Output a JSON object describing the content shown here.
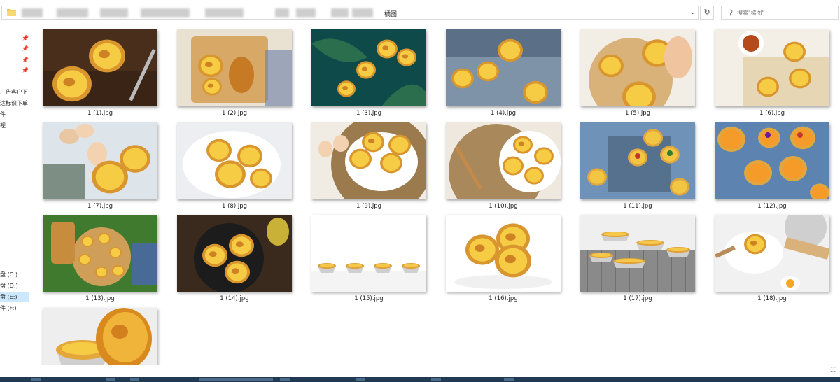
{
  "address_bar": {
    "visible_text": "橘图",
    "dropdown_glyph": "⌄",
    "refresh_glyph": "↻"
  },
  "search": {
    "placeholder": "搜索\"橘图\""
  },
  "nav": {
    "pinned_count": 4,
    "quick_items": [
      "广告客户下",
      "达标识下单",
      "件",
      "视",
      "",
      "",
      "",
      ""
    ],
    "drives": [
      {
        "label": "盘 (C:)",
        "selected": false
      },
      {
        "label": "盘 (D:)",
        "selected": false
      },
      {
        "label": "盘 (E:)",
        "selected": true
      },
      {
        "label": "件 (F:)",
        "selected": false
      }
    ]
  },
  "files": [
    {
      "name": "1 (1).jpg",
      "scene": "egg tarts on dark wood with fork"
    },
    {
      "name": "1 (2).jpg",
      "scene": "egg tarts and croissant on wooden tray"
    },
    {
      "name": "1 (3).jpg",
      "scene": "egg tarts with blueberries on teal leaves"
    },
    {
      "name": "1 (4).jpg",
      "scene": "egg tarts with raisins on blue cloth"
    },
    {
      "name": "1 (5).jpg",
      "scene": "hand holding egg tart over board"
    },
    {
      "name": "1 (6).jpg",
      "scene": "egg tarts with tea on newspaper"
    },
    {
      "name": "1 (7).jpg",
      "scene": "egg tarts with eggs and wheat"
    },
    {
      "name": "1 (8).jpg",
      "scene": "plate of egg tarts with fork"
    },
    {
      "name": "1 (9).jpg",
      "scene": "egg tarts on plate on woven mat"
    },
    {
      "name": "1 (10).jpg",
      "scene": "egg tarts on plate with wooden spoon"
    },
    {
      "name": "1 (11).jpg",
      "scene": "fruit tarts on blue background"
    },
    {
      "name": "1 (12).jpg",
      "scene": "mango fruit tarts on blue"
    },
    {
      "name": "1 (13).jpg",
      "scene": "egg tarts on wooden board on grass"
    },
    {
      "name": "1 (14).jpg",
      "scene": "egg tarts in black pan"
    },
    {
      "name": "1 (15).jpg",
      "scene": "row of four egg tarts on white"
    },
    {
      "name": "1 (16).jpg",
      "scene": "three egg tarts on white"
    },
    {
      "name": "1 (17).jpg",
      "scene": "egg tarts on cooling rack"
    },
    {
      "name": "1 (18).jpg",
      "scene": "egg tart on plate with rolling pin"
    },
    {
      "name": "",
      "scene": "two egg tarts close-up"
    }
  ],
  "status_bar": {
    "view_icon": "details-view-icon"
  },
  "colors": {
    "taskbar": "#1f3a52",
    "selection": "#cce8ff",
    "tart_crust": "#d9962e",
    "tart_custard": "#f6cc45"
  }
}
